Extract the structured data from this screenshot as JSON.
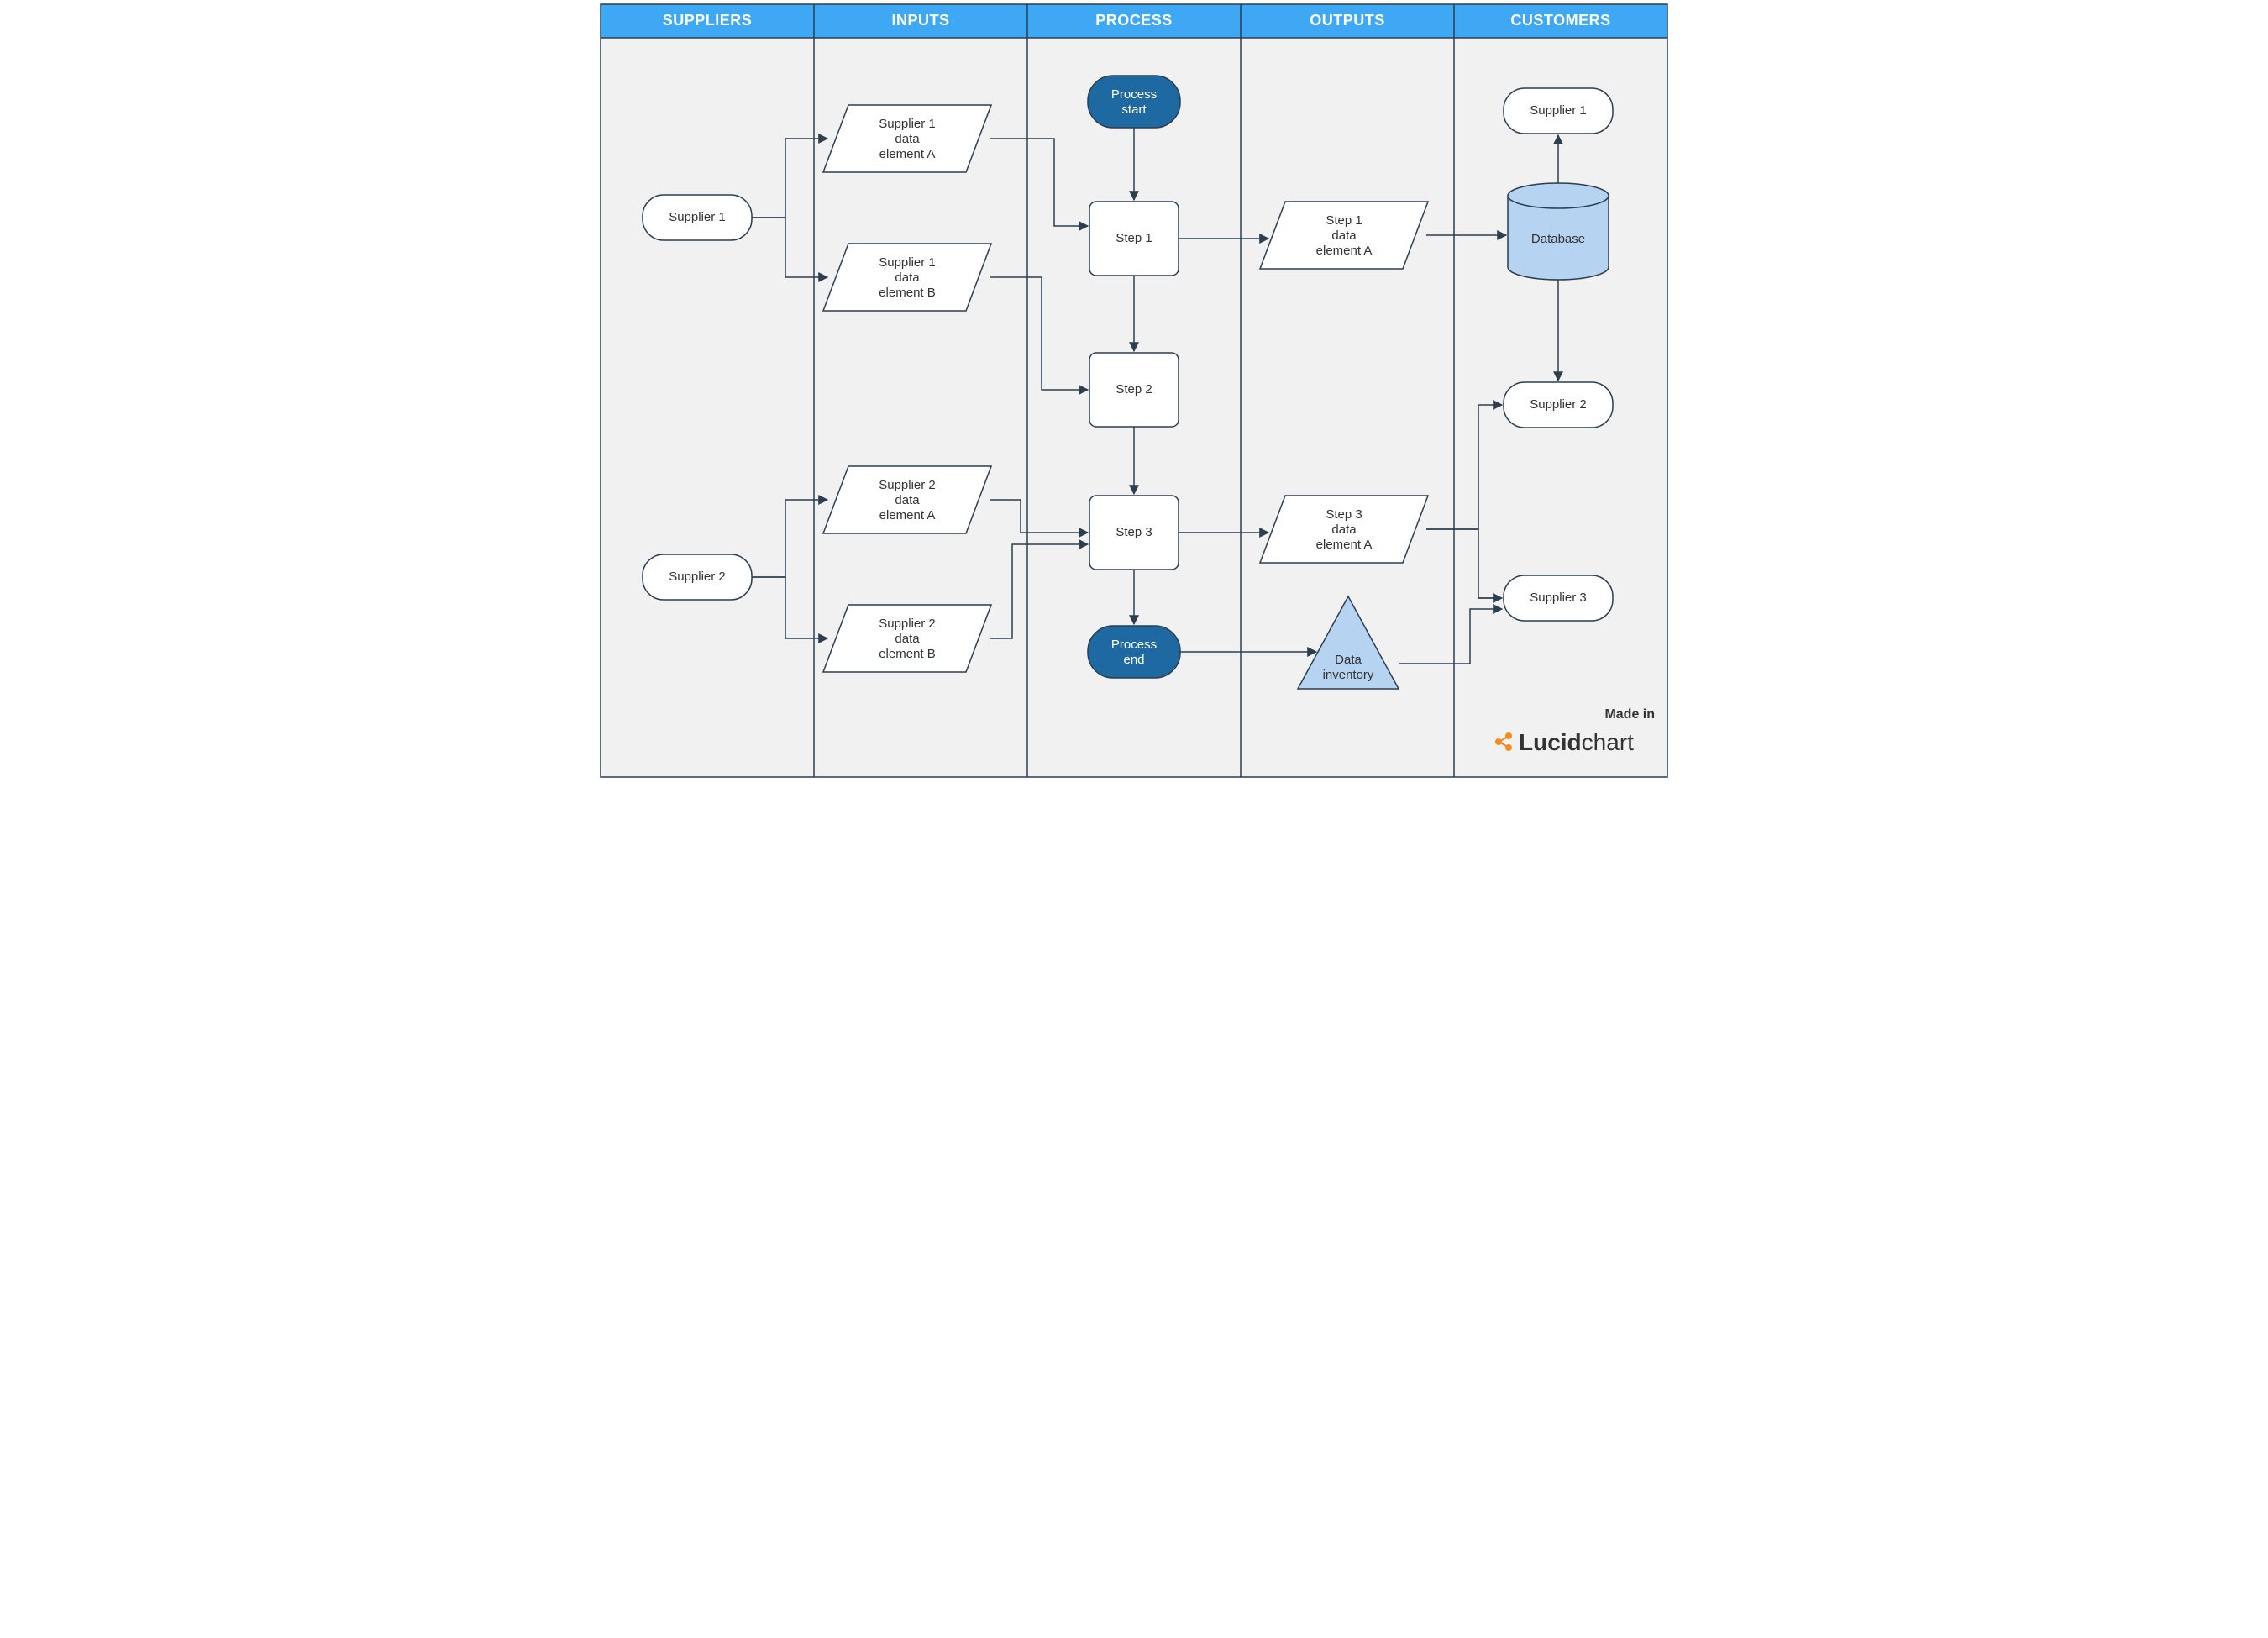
{
  "columns": [
    "SUPPLIERS",
    "INPUTS",
    "PROCESS",
    "OUTPUTS",
    "CUSTOMERS"
  ],
  "suppliers": {
    "s1": "Supplier 1",
    "s2": "Supplier 2"
  },
  "inputs": {
    "s1a_l1": "Supplier 1",
    "s1a_l2": "data",
    "s1a_l3": "element A",
    "s1b_l1": "Supplier 1",
    "s1b_l2": "data",
    "s1b_l3": "element B",
    "s2a_l1": "Supplier 2",
    "s2a_l2": "data",
    "s2a_l3": "element A",
    "s2b_l1": "Supplier 2",
    "s2b_l2": "data",
    "s2b_l3": "element B"
  },
  "process": {
    "start_l1": "Process",
    "start_l2": "start",
    "step1": "Step 1",
    "step2": "Step 2",
    "step3": "Step 3",
    "end_l1": "Process",
    "end_l2": "end"
  },
  "outputs": {
    "o1_l1": "Step 1",
    "o1_l2": "data",
    "o1_l3": "element A",
    "o3_l1": "Step 3",
    "o3_l2": "data",
    "o3_l3": "element A",
    "inv_l1": "Data",
    "inv_l2": "inventory"
  },
  "customers": {
    "c1": "Supplier 1",
    "db": "Database",
    "c2": "Supplier 2",
    "c3": "Supplier 3"
  },
  "watermark": {
    "made": "Made in",
    "brand1": "Lucid",
    "brand2": "chart"
  }
}
